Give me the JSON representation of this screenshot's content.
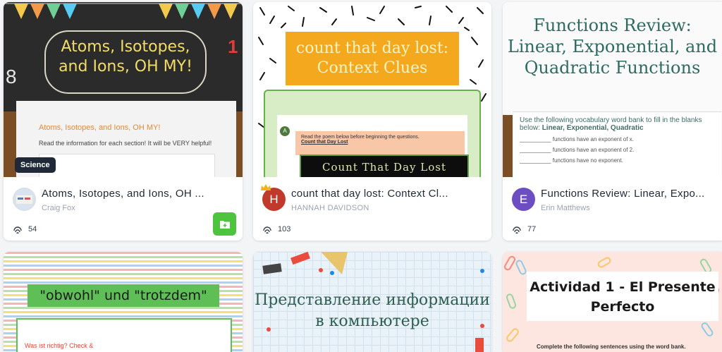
{
  "cards": [
    {
      "badge": "Science",
      "thumb_title": "Atoms, Isotopes, and Ions, OH MY!",
      "thumb_sub_heading": "Atoms, Isotopes, and Ions, OH MY!",
      "thumb_instruction": "Read the information for each section! It will be VERY helpful!",
      "thumb_number": "1",
      "thumb_number2": "8",
      "title": "Atoms, Isotopes, and Ions, OH ...",
      "author": "Craig Fox",
      "stat": "54",
      "avatar_icon": "photo-avatar"
    },
    {
      "thumb_title_line1": "count that day lost:",
      "thumb_title_line2": "Context Clues",
      "thumb_avatar_letter": "A",
      "thumb_instruction": "Read the poem below before beginning the questions.",
      "thumb_poem_link": "Count that Day Lost",
      "thumb_poem_title": "Count That Day Lost",
      "title": "count that day lost: Context Cl...",
      "author": "HANNAH DAVIDSON",
      "stat": "103",
      "avatar_letter": "H",
      "avatar_color": "#c0392b",
      "crown_color": "#f2b31d"
    },
    {
      "thumb_title": "Functions Review: Linear, Exponential, and Quadratic Functions",
      "thumb_instruction_a": "Use the following vocabulary word bank to fill in the blanks below: ",
      "thumb_instruction_b": "Linear, Exponential, Quadratic",
      "thumb_line1": "__________ functions have an exponent of x.",
      "thumb_line2": "__________ functions have an exponent of 2.",
      "thumb_line3": "__________ functions have no exponent.",
      "title": "Functions Review: Linear, Expo...",
      "author": "Erin Matthews",
      "stat": "77",
      "avatar_letter": "E",
      "avatar_color": "#6c4ec2"
    },
    {
      "thumb_title": "\"obwohl\" und \"trotzdem\"",
      "thumb_text": "Was ist richtig? Check &"
    },
    {
      "thumb_title": "Представление информации в компьютере"
    },
    {
      "thumb_title": "Actividad 1 - El Presente Perfecto",
      "thumb_text": "Complete the following sentences using the word bank."
    }
  ],
  "colors": {
    "save_button": "#4ec33d",
    "badge_bg": "#1f2937"
  }
}
